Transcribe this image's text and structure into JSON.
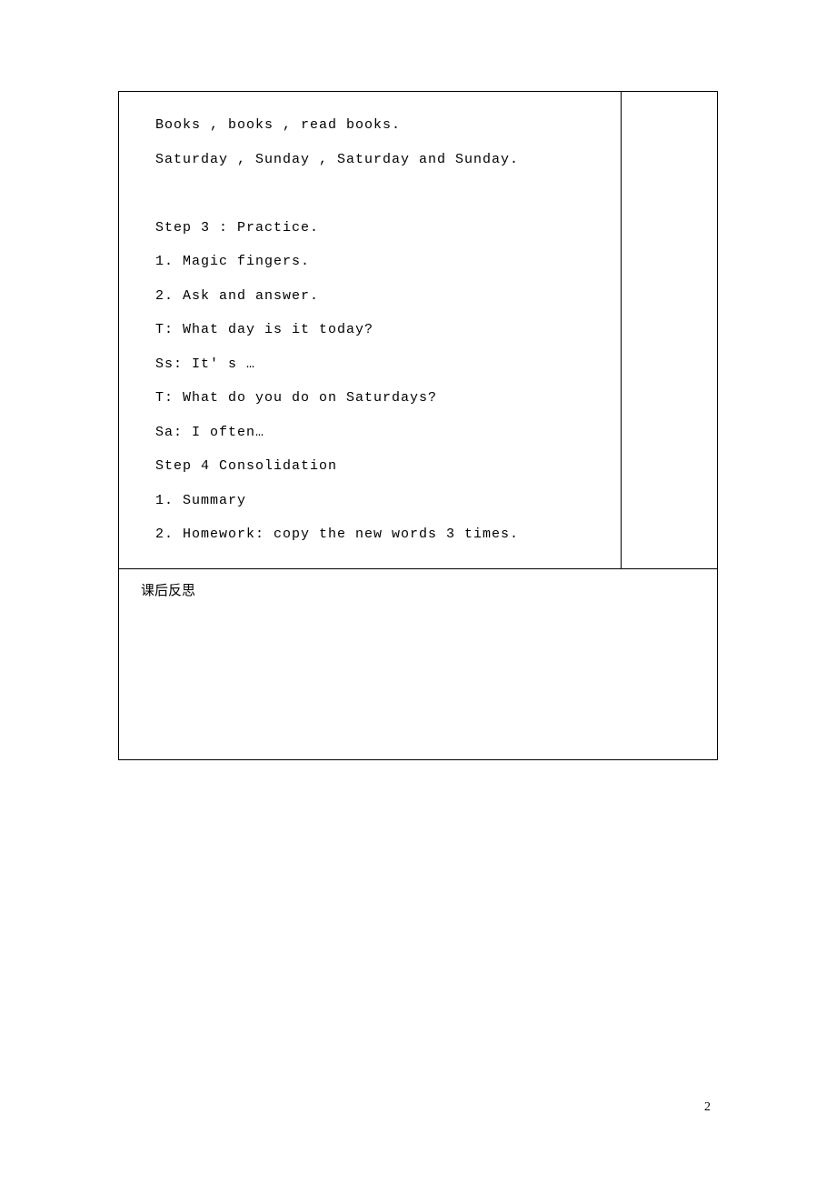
{
  "main": {
    "line1": "Books , books , read books.",
    "line2": "Saturday , Sunday , Saturday and Sunday.",
    "line3": "Step 3 : Practice.",
    "line4": "1.  Magic fingers.",
    "line5": "2.  Ask and answer.",
    "line6": "T: What day is it today?",
    "line7": "Ss: It' s …",
    "line8": "T: What do you do on Saturdays?",
    "line9": "Sa: I often…",
    "line10": "Step 4 Consolidation",
    "line11": "1.  Summary",
    "line12": "2.  Homework: copy the new words 3 times."
  },
  "footer": {
    "label": "课后反思"
  },
  "page": {
    "number": "2"
  }
}
